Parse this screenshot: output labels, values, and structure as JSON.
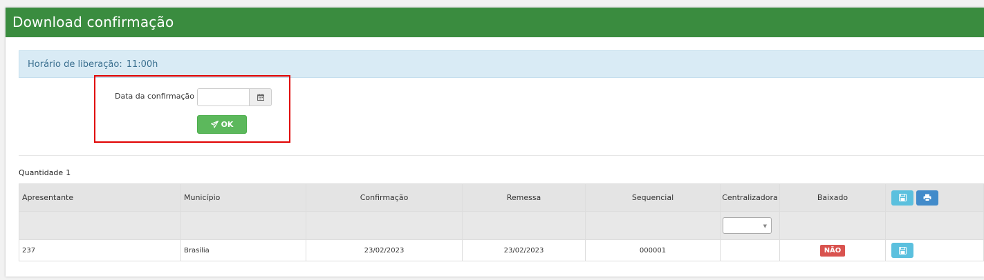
{
  "panel": {
    "title": "Download confirmação"
  },
  "alert": {
    "label": "Horário de liberação:",
    "time": "11:00h"
  },
  "form": {
    "date_label": "Data da confirmação",
    "date_value": "",
    "ok_label": "OK"
  },
  "quantity": {
    "label": "Quantidade",
    "value": "1"
  },
  "table": {
    "columns": [
      "Apresentante",
      "Município",
      "Confirmação",
      "Remessa",
      "Sequencial",
      "Centralizadora",
      "Baixado"
    ],
    "filter_select_value": "",
    "rows": [
      {
        "apresentante": "237",
        "municipio": "Brasília",
        "confirmacao": "23/02/2023",
        "remessa": "23/02/2023",
        "sequencial": "000001",
        "centralizadora": "",
        "baixado": "NÃO"
      }
    ]
  },
  "icons": {
    "calendar": "calendar-icon",
    "ok": "paper-plane-icon",
    "save": "floppy-disk-icon",
    "print": "print-icon"
  },
  "colors": {
    "header": "#3a8c3f",
    "alert_bg": "#d9ebf5",
    "ok_button": "#5cb85c",
    "info_button": "#5bc0de",
    "primary_button": "#428bca",
    "danger_badge": "#d9534f",
    "highlight_border": "#e00000"
  }
}
